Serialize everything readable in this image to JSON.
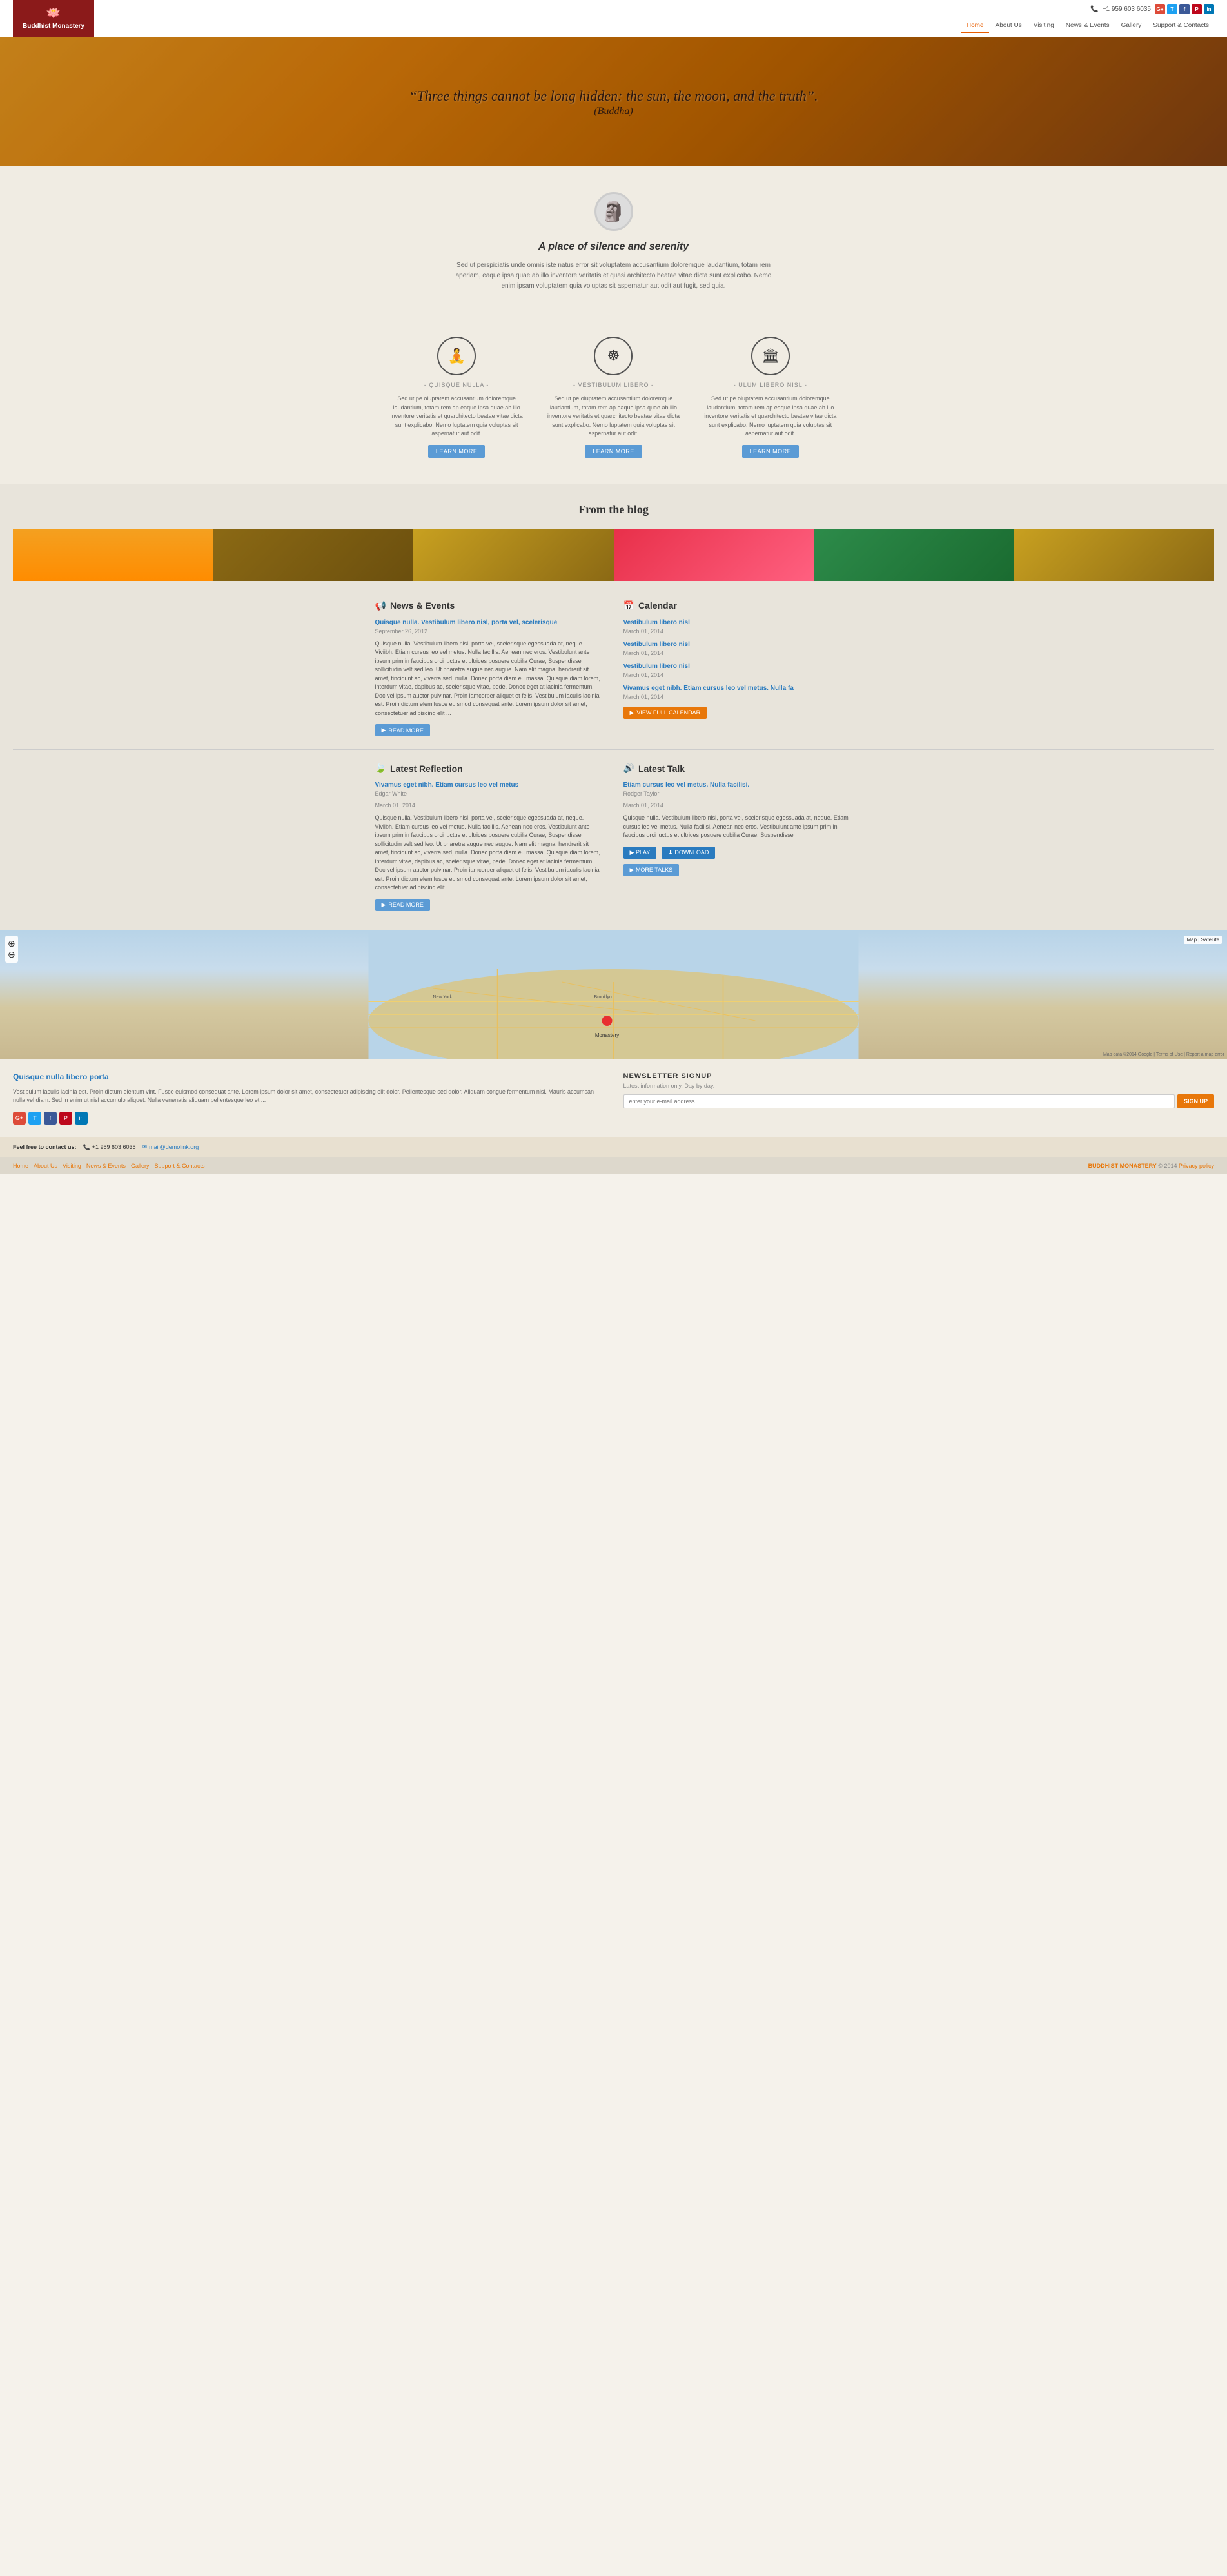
{
  "header": {
    "logo_icon": "🪷",
    "logo_text": "Buddhist Monastery",
    "phone": "+1 959 603 6035",
    "nav": [
      {
        "label": "Home",
        "active": true
      },
      {
        "label": "About Us",
        "active": false
      },
      {
        "label": "Visiting",
        "active": false
      },
      {
        "label": "News & Events",
        "active": false
      },
      {
        "label": "Gallery",
        "active": false
      },
      {
        "label": "Support & Contacts",
        "active": false
      }
    ],
    "social": [
      {
        "label": "G+",
        "color": "#dd4b39"
      },
      {
        "label": "T",
        "color": "#1da1f2"
      },
      {
        "label": "f",
        "color": "#3b5998"
      },
      {
        "label": "P",
        "color": "#bd081c"
      },
      {
        "label": "in",
        "color": "#0077b5"
      }
    ]
  },
  "hero": {
    "quote": "“Three things cannot be long hidden: the sun, the moon, and the truth”.",
    "author": "(Buddha)"
  },
  "intro": {
    "title": "A place of silence and serenity",
    "text": "Sed ut perspiciatis unde omnis iste natus error sit voluptatem accusantium doloremque laudantium, totam rem aperiam, eaque ipsa quae ab illo inventore veritatis et quasi architecto beatae vitae dicta sunt explicabo. Nemo enim ipsam voluptatem quia voluptas sit aspernatur aut odit aut fugit, sed quia."
  },
  "features": [
    {
      "icon": "🧘",
      "title": "- QUISQUE NULLA -",
      "desc": "Sed ut pe oluptatem accusantium doloremque laudantium, totam rem ap eaque ipsa quae ab illo inventore veritatis et quarchitecto beatae vitae dicta sunt explicabo. Nemo luptatem quia voluptas sit aspernatur aut odit.",
      "btn": "LEARN MORE"
    },
    {
      "icon": "☸",
      "title": "- VESTIBULUM LIBERO -",
      "desc": "Sed ut pe oluptatem accusantium doloremque laudantium, totam rem ap eaque ipsa quae ab illo inventore veritatis et quarchitecto beatae vitae dicta sunt explicabo. Nemo luptatem quia voluptas sit aspernatur aut odit.",
      "btn": "LEARN MORE"
    },
    {
      "icon": "🏛",
      "title": "- ULUM LIBERO NISL -",
      "desc": "Sed ut pe oluptatem accusantium doloremque laudantium, totam rem ap eaque ipsa quae ab illo inventore veritatis et quarchitecto beatae vitae dicta sunt explicabo. Nemo luptatem quia voluptas sit aspernatur aut odit.",
      "btn": "LEARN MORE"
    }
  ],
  "blog": {
    "section_title": "From the blog"
  },
  "news": {
    "title": "News & Events",
    "item": {
      "link": "Quisque nulla. Vestibulum libero nisl, porta vel, scelerisque",
      "date": "September 26, 2012",
      "text": "Quisque nulla. Vestibulum libero nisl, porta vel, scelerisque egessuada at, neque. Viviibh. Etiam cursus leo vel metus. Nulla facillis. Aenean nec eros. Vestibulunt ante ipsum prim in faucibus orci luctus et ultrices posuere cubilia Curae; Suspendisse sollicitudin velt sed leo. Ut pharetra augue nec augue. Nam elit magna, hendrerit sit amet, tincidunt ac, viverra sed, nulla. Donec porta diam eu massa. Quisque diam lorem, interdum vitae, dapibus ac, scelerisque vitae, pede. Donec eget at lacinia fermentum. Doc vel ipsum auctor pulvinar. Proin iamcorper aliquet et felis. Vestibulum iaculis lacinia est. Proin dictum elemifusce euismod consequat ante. Lorem ipsum dolor sit amet, consectetuer adipiscing elit ...",
      "read_more": "READ MORE"
    }
  },
  "calendar": {
    "title": "Calendar",
    "items": [
      {
        "link": "Vestibulum libero nisl",
        "date": "March 01, 2014"
      },
      {
        "link": "Vestibulum libero nisl",
        "date": "March 01, 2014"
      },
      {
        "link": "Vestibulum libero nisl",
        "date": "March 01, 2014"
      },
      {
        "link": "Vivamus eget nibh. Etiam cursus leo vel metus. Nulla fa",
        "date": "March 01, 2014"
      }
    ],
    "view_btn": "VIEW FULL CALENDAR"
  },
  "reflection": {
    "title": "Latest Reflection",
    "link": "Vivamus eget nibh. Etiam cursus leo vel metus",
    "author": "Edgar White",
    "date": "March 01, 2014",
    "text": "Quisque nulla. Vestibulum libero nisl, porta vel, scelerisque egessuada at, neque. Viviibh. Etiam cursus leo vel metus. Nulla facillis. Aenean nec eros. Vestibulunt ante ipsum prim in faucibus orci luctus et ultrices posuere cubilia Curae; Suspendisse sollicitudin velt sed leo. Ut pharetra augue nec augue. Nam elit magna, hendrerit sit amet, tincidunt ac, viverra sed, nulla. Donec porta diam eu massa. Quisque diam lorem, interdum vitae, dapibus ac, scelerisque vitae, pede. Donec eget at lacinia fermentum. Doc vel ipsum auctor pulvinar. Proin iamcorper aliquet et felis. Vestibulum iaculis lacinia est. Proin dictum elemifusce euismod consequat ante. Lorem ipsum dolor sit amet, consectetuer adipiscing elit ...",
    "read_more": "READ MORE"
  },
  "latest_talk": {
    "title": "Latest Talk",
    "link": "Etiam cursus leo vel metus. Nulla facilisi.",
    "author": "Rodger Taylor",
    "date": "March 01, 2014",
    "text": "Quisque nulla. Vestibulum libero nisl, porta vel, scelerisque egessuada at, neque. Etiam cursus leo vel metus. Nulla facilisi. Aenean nec eros. Vestibulunt ante ipsum prim in faucibus orci luctus et ultrices posuere cubilia Curae. Suspendisse",
    "play_btn": "PLAY",
    "download_btn": "DOWNLOAD",
    "more_talks_btn": "MORE TALKS"
  },
  "footer": {
    "col1_title": "Quisque nulla libero porta",
    "col1_text": "Vestibulum iaculis lacinia est. Proin dictum elentum vint. Fusce euismod consequat ante. Lorem ipsum dolor sit amet, consectetuer adipiscing elit dolor. Pellentesque sed dolor. Aliquam congue fermentum nisl. Mauris accumsan nulla vel diam. Sed in enim ut nisl accumulo aliquet. Nulla venenatis aliquam pellentesque leo et ...",
    "social": [
      {
        "label": "G+",
        "color": "#dd4b39"
      },
      {
        "label": "T",
        "color": "#1da1f2"
      },
      {
        "label": "f",
        "color": "#3b5998"
      },
      {
        "label": "P",
        "color": "#bd081c"
      },
      {
        "label": "in",
        "color": "#0077b5"
      }
    ],
    "newsletter_title": "NEWSLETTER SIGNUP",
    "newsletter_sub": "Latest information only. Day by day.",
    "newsletter_placeholder": "enter your e-mail address",
    "signup_btn": "SIGN UP",
    "contact_label": "Feel free to contact us:",
    "phone": "+1 959 603 6035",
    "email": "mail@demolink.org",
    "nav_links": [
      "Home",
      "About Us",
      "Visiting",
      "News & Events",
      "Gallery",
      "Support & Contacts"
    ],
    "copyright": "BUDDHIST MONASTERY © 2014 Privacy policy"
  }
}
